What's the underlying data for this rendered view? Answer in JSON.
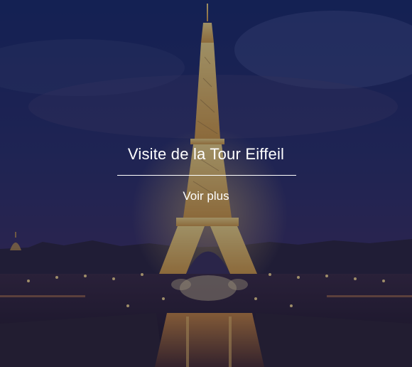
{
  "card": {
    "title": "Visite de la Tour Eiffeil",
    "link_label": "Voir plus"
  },
  "image": {
    "subject": "eiffel-tower-night"
  },
  "colors": {
    "sky_top": "#182a63",
    "sky_bottom": "#3a3262",
    "tower_light": "#e8c35a",
    "overlay": "#101234",
    "text": "#ffffff"
  }
}
